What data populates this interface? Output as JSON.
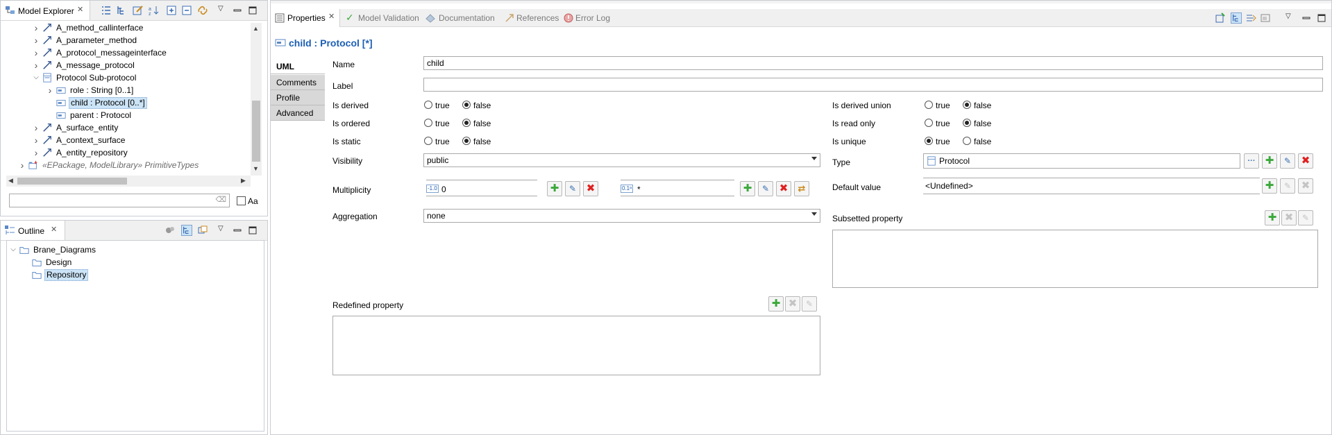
{
  "explorer": {
    "tab_title": "Model Explorer",
    "tree": [
      {
        "label": "A_method_callinterface",
        "indent": 1,
        "expand": "collapsed",
        "icon": "association-icon"
      },
      {
        "label": "A_parameter_method",
        "indent": 1,
        "expand": "collapsed",
        "icon": "association-icon"
      },
      {
        "label": "A_protocol_messageinterface",
        "indent": 1,
        "expand": "collapsed",
        "icon": "association-icon"
      },
      {
        "label": "A_message_protocol",
        "indent": 1,
        "expand": "collapsed",
        "icon": "association-icon"
      },
      {
        "label": "Protocol Sub-protocol",
        "indent": 1,
        "expand": "expanded",
        "icon": "class-icon"
      },
      {
        "label": "role : String [0..1]",
        "indent": 2,
        "expand": "collapsed",
        "icon": "property-icon"
      },
      {
        "label": "child : Protocol [0..*]",
        "indent": 2,
        "expand": "none",
        "icon": "property-icon",
        "selected": true
      },
      {
        "label": "parent : Protocol",
        "indent": 2,
        "expand": "none",
        "icon": "property-icon"
      },
      {
        "label": "A_surface_entity",
        "indent": 1,
        "expand": "collapsed",
        "icon": "association-icon"
      },
      {
        "label": "A_context_surface",
        "indent": 1,
        "expand": "collapsed",
        "icon": "association-icon"
      },
      {
        "label": "A_entity_repository",
        "indent": 1,
        "expand": "collapsed",
        "icon": "association-icon"
      },
      {
        "label": "«EPackage, ModelLibrary» PrimitiveTypes",
        "indent": 0,
        "expand": "collapsed",
        "icon": "package-import-icon",
        "italic": true
      }
    ],
    "filter_placeholder": "",
    "case_label": "Aa"
  },
  "outline": {
    "tab_title": "Outline",
    "tree": [
      {
        "label": "Brane_Diagrams",
        "indent": 0,
        "expand": "expanded"
      },
      {
        "label": "Design",
        "indent": 1,
        "expand": "none"
      },
      {
        "label": "Repository",
        "indent": 1,
        "expand": "none",
        "selected": true
      }
    ]
  },
  "properties": {
    "tabs": [
      "Properties",
      "Model Validation",
      "Documentation",
      "References",
      "Error Log"
    ],
    "header_title": "child : Protocol [*]",
    "side_tabs": [
      "UML",
      "Comments",
      "Profile",
      "Advanced"
    ],
    "name_label": "Name",
    "name_value": "child",
    "label_label": "Label",
    "label_value": "",
    "true_text": "true",
    "false_text": "false",
    "left_bools": [
      {
        "label": "Is derived",
        "value": "false"
      },
      {
        "label": "Is ordered",
        "value": "false"
      },
      {
        "label": "Is static",
        "value": "false"
      }
    ],
    "right_bools": [
      {
        "label": "Is derived union",
        "value": "false"
      },
      {
        "label": "Is read only",
        "value": "false"
      },
      {
        "label": "Is unique",
        "value": "true"
      }
    ],
    "visibility_label": "Visibility",
    "visibility_value": "public",
    "type_label": "Type",
    "type_value": "Protocol",
    "multiplicity_label": "Multiplicity",
    "lower_icon_text": "-1.0",
    "lower_value": "0",
    "upper_icon_text": "0.1ᵃ",
    "upper_value": "*",
    "default_label": "Default value",
    "default_value": "<Undefined>",
    "aggregation_label": "Aggregation",
    "aggregation_value": "none",
    "subsetted_label": "Subsetted property",
    "redefined_label": "Redefined property",
    "browse_text": "···"
  },
  "colors": {
    "title_blue": "#1c5fb4",
    "selection": "#cce4f7",
    "add_green": "#3ba83b",
    "delete_red": "#e02020"
  }
}
